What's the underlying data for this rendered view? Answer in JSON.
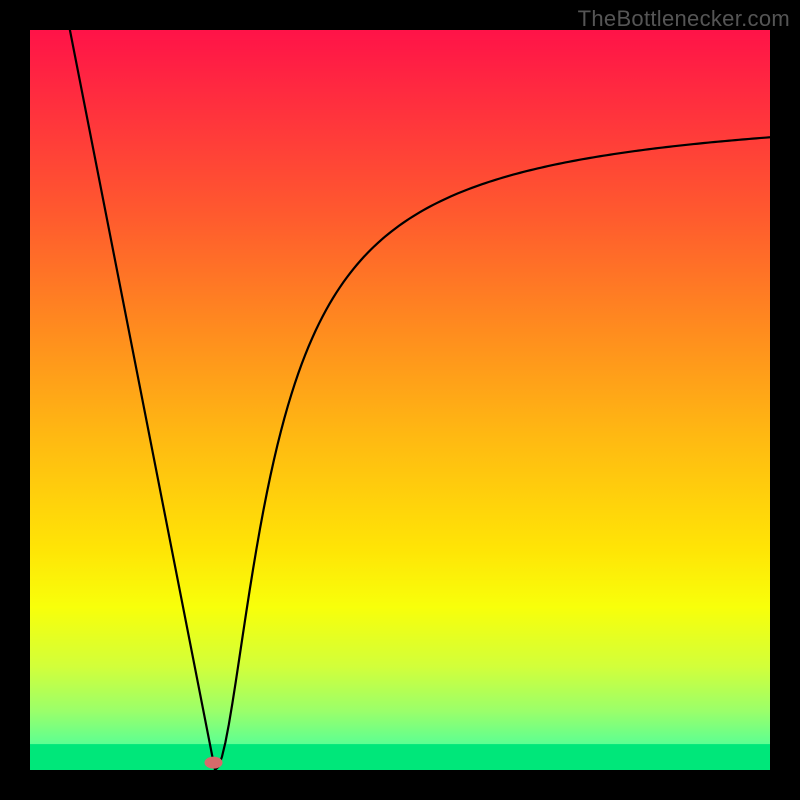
{
  "watermark": "TheBottlenecker.com",
  "chart_data": {
    "type": "line",
    "title": "",
    "xlabel": "",
    "ylabel": "",
    "xlim": [
      0,
      100
    ],
    "ylim": [
      0,
      100
    ],
    "background": {
      "gradient_stops": [
        {
          "offset": 0.0,
          "color": "#ff1348"
        },
        {
          "offset": 0.1,
          "color": "#ff2f3e"
        },
        {
          "offset": 0.25,
          "color": "#ff5a2e"
        },
        {
          "offset": 0.4,
          "color": "#ff8a1f"
        },
        {
          "offset": 0.55,
          "color": "#ffb912"
        },
        {
          "offset": 0.7,
          "color": "#ffe406"
        },
        {
          "offset": 0.78,
          "color": "#f8ff0a"
        },
        {
          "offset": 0.86,
          "color": "#d2ff3a"
        },
        {
          "offset": 0.92,
          "color": "#9bff6a"
        },
        {
          "offset": 0.965,
          "color": "#5dff92"
        },
        {
          "offset": 1.0,
          "color": "#00e77a"
        }
      ],
      "green_band_top": 0.965
    },
    "curve": {
      "x_min": 25,
      "left_start_x": 5,
      "left_start_y": 102,
      "right_end_x": 100,
      "right_end_y": 91,
      "asymptote_scale": 140
    },
    "marker": {
      "x": 24.8,
      "y": 1.0,
      "color": "#d66b6b",
      "rx": 9,
      "ry": 6
    },
    "stroke": {
      "color": "#000000",
      "width": 2.2
    }
  }
}
